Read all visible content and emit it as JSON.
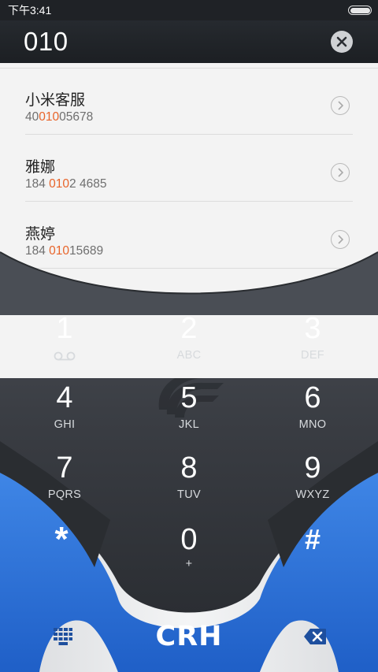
{
  "status_bar": {
    "time": "下午3:41"
  },
  "dial_bar": {
    "number": "010"
  },
  "contacts": [
    {
      "name": "小米客服",
      "number_pre": "40",
      "number_match": "010",
      "number_post": "05678"
    },
    {
      "name": "雅娜",
      "number_pre": "184 ",
      "number_match": "010",
      "number_post": "2 4685"
    },
    {
      "name": "燕婷",
      "number_pre": "184 ",
      "number_match": "010",
      "number_post": "15689"
    }
  ],
  "keypad": [
    {
      "digit": "1",
      "letters": ""
    },
    {
      "digit": "2",
      "letters": "ABC"
    },
    {
      "digit": "3",
      "letters": "DEF"
    },
    {
      "digit": "4",
      "letters": "GHI"
    },
    {
      "digit": "5",
      "letters": "JKL"
    },
    {
      "digit": "6",
      "letters": "MNO"
    },
    {
      "digit": "7",
      "letters": "PQRS"
    },
    {
      "digit": "8",
      "letters": "TUV"
    },
    {
      "digit": "9",
      "letters": "WXYZ"
    },
    {
      "digit": "*",
      "letters": ""
    },
    {
      "digit": "0",
      "letters": "+"
    },
    {
      "digit": "#",
      "letters": ""
    }
  ],
  "bottom_bar": {
    "brand": "CRH",
    "left_icon": "keypad-grid-icon",
    "right_icon": "backspace-icon"
  },
  "colors": {
    "match_highlight": "#e8642a",
    "accent_blue": "#2f74d6",
    "keypad_dark": "#3b3f45",
    "list_bg": "#f3f3f3"
  }
}
